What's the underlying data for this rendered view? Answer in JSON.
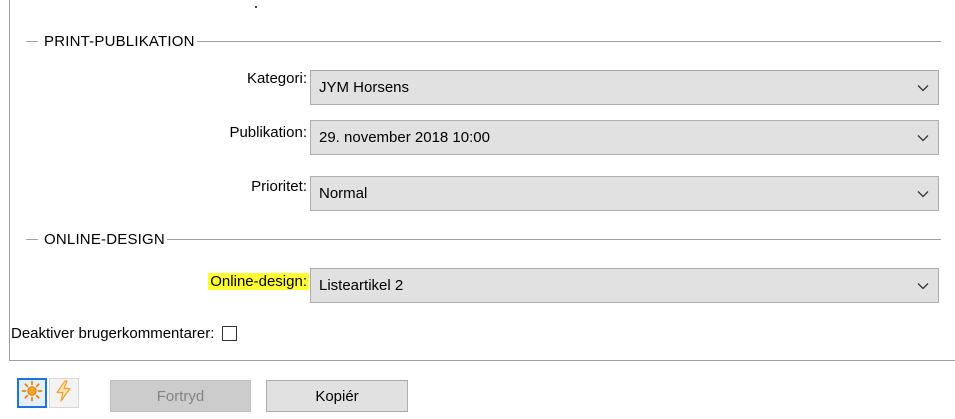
{
  "print_group": {
    "title": "PRINT-PUBLIKATION",
    "fields": [
      {
        "label": "Kategori:",
        "value": "JYM Horsens"
      },
      {
        "label": "Publikation:",
        "value": "29. november 2018 10:00"
      },
      {
        "label": "Prioritet:",
        "value": "Normal"
      }
    ]
  },
  "online_group": {
    "title": "ONLINE-DESIGN",
    "design_label": "Online-design:",
    "design_value": "Listeartikel 2",
    "comments_label": "Deaktiver brugerkommentarer:",
    "comments_checked": false
  },
  "toolbar": {
    "sun_icon": "sun-icon",
    "lightning_icon": "lightning-icon",
    "undo_label": "Fortryd",
    "copy_label": "Kopiér"
  },
  "colors": {
    "highlight": "#ffff33",
    "accent": "#1c75d8",
    "icon_orange": "#f5a623"
  }
}
